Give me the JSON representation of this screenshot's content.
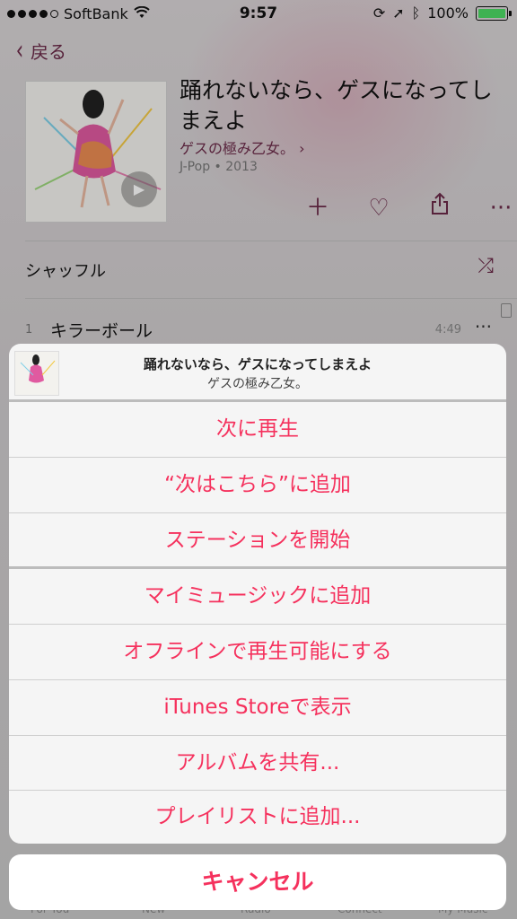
{
  "status_bar": {
    "carrier": "SoftBank",
    "time": "9:57",
    "battery": "100%"
  },
  "nav": {
    "back_label": "戻る"
  },
  "album": {
    "title": "踊れないなら、ゲスになってしまえよ",
    "artist": "ゲスの極み乙女。",
    "meta": "J-Pop • 2013"
  },
  "shuffle": {
    "label": "シャッフル"
  },
  "tracks": [
    {
      "number": "1",
      "title": "キラーボール",
      "duration": "4:49"
    }
  ],
  "sheet": {
    "title": "踊れないなら、ゲスになってしまえよ",
    "subtitle": "ゲスの極み乙女。",
    "items": [
      "次に再生",
      "“次はこちら”に追加",
      "ステーションを開始",
      "マイミュージックに追加",
      "オフラインで再生可能にする",
      "iTunes Storeで表示",
      "アルバムを共有...",
      "プレイリストに追加..."
    ],
    "cancel": "キャンセル"
  },
  "tabs": [
    "For You",
    "New",
    "Radio",
    "Connect",
    "My Music"
  ],
  "colors": {
    "accent": "#f5315d",
    "tint": "#6b2a48"
  },
  "icons": [
    "back-chevron-icon",
    "play-icon",
    "add-icon",
    "heart-icon",
    "share-icon",
    "more-icon",
    "shuffle-icon"
  ]
}
